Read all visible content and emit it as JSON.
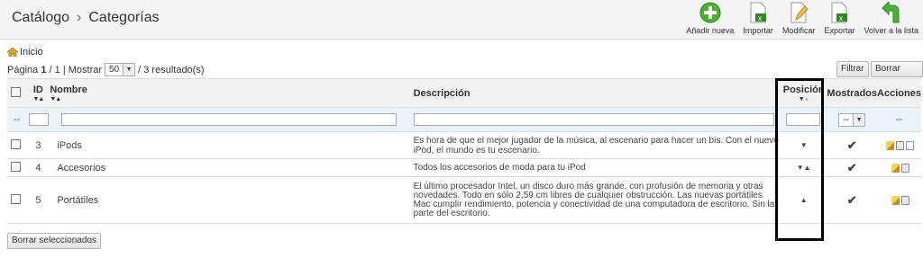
{
  "breadcrumb": {
    "section": "Catálogo",
    "separator": "›",
    "page": "Categorías"
  },
  "toolbar": {
    "add_label": "Añadir nueva",
    "import_label": "Importar",
    "modify_label": "Modificar",
    "export_label": "Exportar",
    "back_label": "Volver a la lista"
  },
  "home_link": "Inicio",
  "pagination": {
    "page_prefix": "Página",
    "current_page": "1",
    "total_pages": "/ 1",
    "show_label": "| Mostrar",
    "per_page": "50",
    "results": "/ 3 resultado(s)"
  },
  "filter_buttons": {
    "filter": "Filtrar",
    "reset": "Borrar filtro"
  },
  "columns": {
    "id": "ID",
    "name": "Nombre",
    "description": "Descripción",
    "position": "Posición",
    "shown": "Mostrados",
    "actions": "Acciones"
  },
  "filter_row": {
    "dash": "--",
    "shown_select": "--",
    "actions_dash": "--"
  },
  "rows": [
    {
      "id": "3",
      "name": "iPods",
      "description": "Es hora de que el mejor jugador de la música, al escenario para hacer un bis. Con el nuevo iPod, el mundo es tu escenario.",
      "position_arrows": "▼",
      "shown": "✔"
    },
    {
      "id": "4",
      "name": "Accesorios",
      "description": "Todos los accesorios de moda para tu iPod",
      "position_arrows": "▼▲",
      "shown": "✔"
    },
    {
      "id": "5",
      "name": "Portátiles",
      "description": "El último procesador Intel, un disco duro más grande, con profusión de memoria y otras novedades. Todo en sólo 2,59 cm libres de cualquier obstrucción. Las nuevas portátiles Mac cumplir rendimiento, potencia y conectividad de una computadora de escritorio. Sin la parte del escritorio.",
      "position_arrows": "▲",
      "shown": "✔"
    }
  ],
  "bulk_delete_label": "Borrar seleccionados",
  "colors": {
    "header_bg": "#f4f4f4",
    "filter_bg": "#e9f1f9",
    "check_green": "#3aa628",
    "add_green": "#4cb135"
  }
}
